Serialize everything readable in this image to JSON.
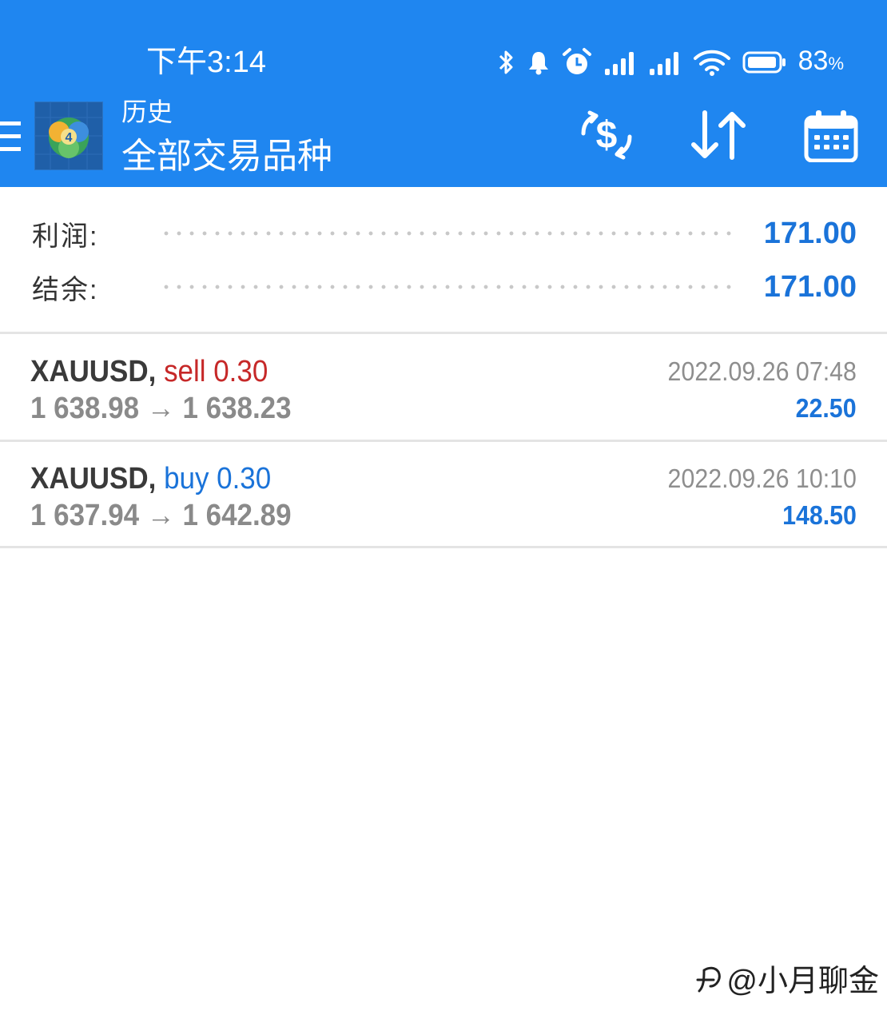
{
  "status_bar": {
    "time": "下午3:14",
    "battery_value": "83",
    "battery_unit": "%"
  },
  "app_bar": {
    "title_small": "历史",
    "title_big": "全部交易品种",
    "color": "#1f86f0",
    "icons": [
      "menu-icon",
      "metatrader-logo",
      "currency-exchange-icon",
      "sort-icon",
      "calendar-icon"
    ]
  },
  "summary": {
    "profit_label": "利润:",
    "profit_value": "171.00",
    "balance_label": "结余:",
    "balance_value": "171.00"
  },
  "trades": [
    {
      "symbol": "XAUUSD,",
      "side": "sell 0.30",
      "prices": "1 638.98 → 1 638.23",
      "time": "2022.09.26 07:48",
      "profit": "22.50"
    },
    {
      "symbol": "XAUUSD,",
      "side": "buy 0.30",
      "prices": "1 637.94 → 1 642.89",
      "time": "2022.09.26 10:10",
      "profit": "148.50"
    }
  ],
  "watermark": {
    "text": "@小月聊金"
  },
  "colors": {
    "accent": "#1a73d9",
    "sell": "#c62828"
  }
}
